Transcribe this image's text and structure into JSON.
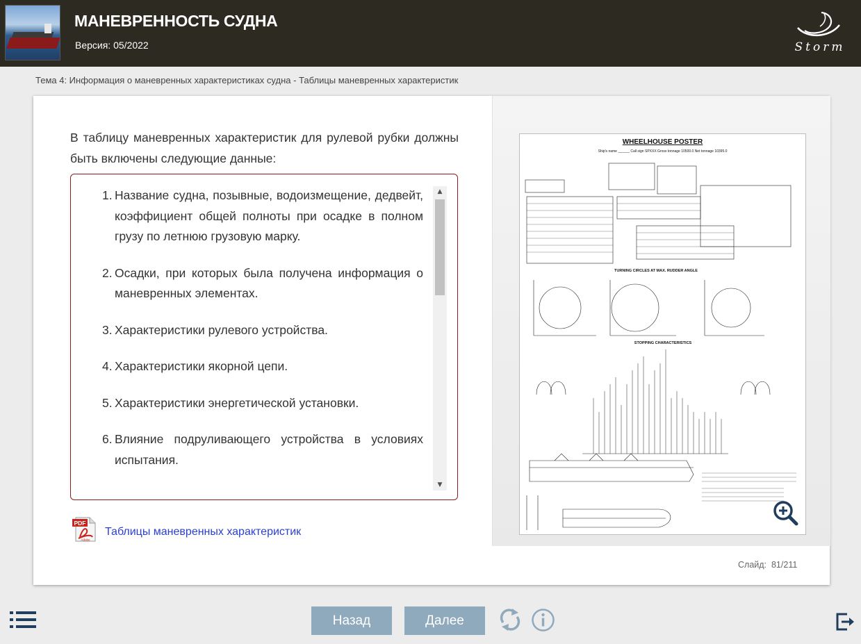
{
  "header": {
    "title": "МАНЕВРЕННОСТЬ СУДНА",
    "version": "Версия: 05/2022",
    "logo_text": "Storm"
  },
  "breadcrumb": "Тема 4: Информация о маневренных характеристиках судна - Таблицы маневренных характеристик",
  "content": {
    "intro": "В таблицу маневренных характеристик для рулевой рубки должны быть включены следующие данные:",
    "items": [
      {
        "num": "1.",
        "text": "Название судна, позывные, водоизмещение, дедвейт, коэффициент общей полноты при осадке в полном грузу по летнюю грузовую марку."
      },
      {
        "num": "2.",
        "text": "Осадки, при которых была получена информация о маневренных элементах."
      },
      {
        "num": "3.",
        "text": "Характеристики рулевого устройства."
      },
      {
        "num": "4.",
        "text": "Характеристики якорной цепи."
      },
      {
        "num": "5.",
        "text": "Характеристики энергетической установки."
      },
      {
        "num": "6.",
        "text": "Влияние подруливающего устройства в условиях испытания."
      }
    ],
    "pdf_icon_text": "PDF",
    "pdf_icon_brand": "Adobe",
    "pdf_link": "Таблицы маневренных характеристик"
  },
  "poster": {
    "title": "WHEELHOUSE POSTER",
    "ship_line": "Ship's name ______   Call sign SPXXX   Gross tonnage 10500.0   Net tonnage 10395.0",
    "section_turning": "TURNING CIRCLES AT MAX. RUDDER ANGLE",
    "section_stopping": "STOPPING CHARACTERISTICS"
  },
  "slide": {
    "label": "Слайд:",
    "current": "81",
    "total": "211"
  },
  "nav": {
    "back": "Назад",
    "next": "Далее"
  },
  "colors": {
    "header_bg": "#2d2a22",
    "list_border": "#8c1c1c",
    "nav_button": "#8fa9bd",
    "icon_blue": "#1f3d5c",
    "link": "#2a3fd6"
  }
}
